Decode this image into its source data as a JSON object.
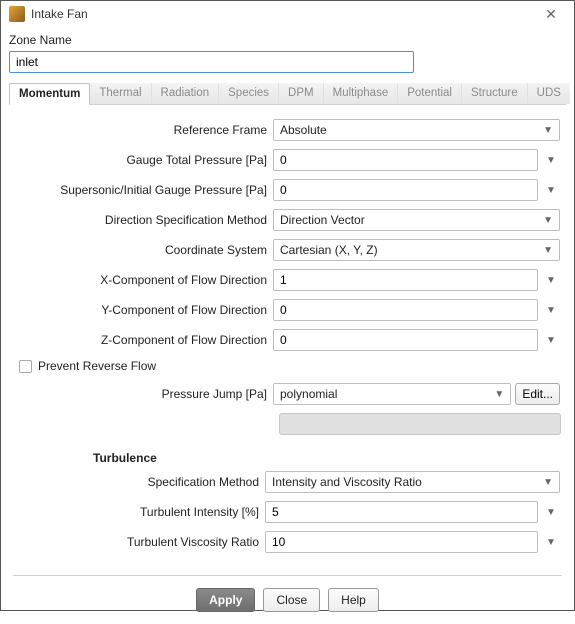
{
  "window": {
    "title": "Intake Fan"
  },
  "zone": {
    "label": "Zone Name",
    "value": "inlet"
  },
  "tabs": [
    "Momentum",
    "Thermal",
    "Radiation",
    "Species",
    "DPM",
    "Multiphase",
    "Potential",
    "Structure",
    "UDS"
  ],
  "fields": {
    "reference_frame": {
      "label": "Reference Frame",
      "value": "Absolute"
    },
    "gauge_total_pressure": {
      "label": "Gauge Total Pressure [Pa]",
      "value": "0"
    },
    "supersonic_pressure": {
      "label": "Supersonic/Initial Gauge Pressure [Pa]",
      "value": "0"
    },
    "direction_method": {
      "label": "Direction Specification Method",
      "value": "Direction Vector"
    },
    "coordinate_system": {
      "label": "Coordinate System",
      "value": "Cartesian (X, Y, Z)"
    },
    "x_component": {
      "label": "X-Component of Flow Direction",
      "value": "1"
    },
    "y_component": {
      "label": "Y-Component of Flow Direction",
      "value": "0"
    },
    "z_component": {
      "label": "Z-Component of Flow Direction",
      "value": "0"
    },
    "prevent_reverse": {
      "label": "Prevent Reverse Flow"
    },
    "pressure_jump": {
      "label": "Pressure Jump [Pa]",
      "value": "polynomial",
      "edit": "Edit..."
    }
  },
  "turbulence": {
    "title": "Turbulence",
    "spec_method": {
      "label": "Specification Method",
      "value": "Intensity and Viscosity Ratio"
    },
    "intensity": {
      "label": "Turbulent Intensity [%]",
      "value": "5"
    },
    "viscosity_ratio": {
      "label": "Turbulent Viscosity Ratio",
      "value": "10"
    }
  },
  "footer": {
    "apply": "Apply",
    "close": "Close",
    "help": "Help"
  }
}
